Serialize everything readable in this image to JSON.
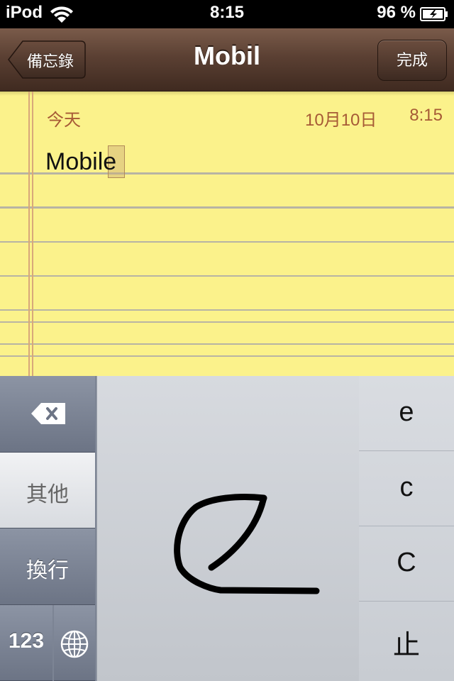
{
  "status_bar": {
    "carrier": "iPod",
    "time": "8:15",
    "battery_percent": "96 %"
  },
  "nav": {
    "back_label": "備忘錄",
    "title": "Mobil",
    "done_label": "完成"
  },
  "note": {
    "day": "今天",
    "date": "10月10日",
    "time": "8:15",
    "body": "Mobile"
  },
  "keyboard": {
    "other_label": "其他",
    "return_label": "換行",
    "numbers_label": "123",
    "candidates": [
      "e",
      "c",
      "C",
      "止"
    ]
  },
  "colors": {
    "paper": "#fbf28b",
    "nav_brown": "#5b4033",
    "date_text": "#a65a36"
  },
  "icons": {
    "delete": "delete-icon",
    "globe": "globe-icon",
    "wifi": "wifi-icon",
    "battery": "battery-icon"
  }
}
